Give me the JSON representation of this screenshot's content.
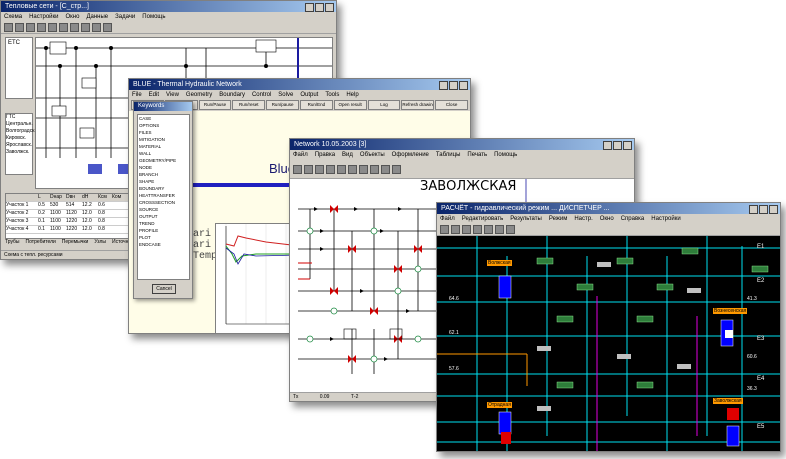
{
  "windows": {
    "w1": {
      "title": "Тепловые сети - [С_стр...]",
      "menu": [
        "Схема",
        "Настройки",
        "Окно",
        "Данные",
        "Задачи",
        "Помощь"
      ],
      "tree_root": "ЕТС",
      "list_items": [
        "ГТС",
        "Центральн.",
        "Волгоградск.",
        "Кировск.",
        "Ярославск.",
        "Заволжск."
      ],
      "table_headers": [
        "",
        "L",
        "Dнар",
        "Dвн",
        "dH",
        "Ксм",
        "Ком"
      ],
      "table_rows": [
        [
          "Участок 1",
          "0.5",
          "530",
          "514",
          "12.2",
          "0.6",
          ""
        ],
        [
          "Участок 2",
          "0.2",
          "1100",
          "1120",
          "12.0",
          "0.8",
          ""
        ],
        [
          "Участок 3",
          "0.1",
          "1100",
          "1220",
          "12.0",
          "0.8",
          ""
        ],
        [
          "Участок 4",
          "0.1",
          "1100",
          "1220",
          "12.0",
          "0.8",
          ""
        ]
      ],
      "tabs": [
        "Трубы",
        "Потребители",
        "Перемычки",
        "Узлы",
        "Источники"
      ],
      "status": "Схема с тепл. ресурсами"
    },
    "w2": {
      "title": "BLUE - Thermal Hydraulic Network",
      "menu": [
        "File",
        "Edit",
        "View",
        "Geometry",
        "Boundary",
        "Control",
        "Solve",
        "Output",
        "Tools",
        "Help"
      ],
      "buttons": [
        "Open",
        "Run/Stop",
        "Run/Pause",
        "Run/reset",
        "Run/pause",
        "Run/End",
        "Open result",
        "Log",
        "Refresh drawing",
        "Close"
      ],
      "blue_text": "BlueSt",
      "side_text": [
        "ari",
        "ari",
        "Temp"
      ],
      "popup_title": "Keywords",
      "keywords": [
        "CASE",
        "OPTIONS",
        "FILES",
        "MITIGATION",
        "MATERIAL",
        "WALL",
        "GEOMETRY/PIPE",
        "NODE",
        "BRANCH",
        "SHAPE",
        "BOUNDARY",
        "HEATTRANSFER",
        "CROSSSECTION",
        "SOURCE",
        "OUTPUT",
        "TREND",
        "PROFILE",
        "PLOT",
        "ENDCASE"
      ],
      "popup_button": "Cancel"
    },
    "w3": {
      "title": "Network 10.05.2003 [3]",
      "menu": [
        "Файл",
        "Правка",
        "Вид",
        "Объекты",
        "Оформление",
        "Таблицы",
        "Печать",
        "Помощь"
      ],
      "heading": "ЗАВОЛЖСКАЯ",
      "status": [
        "Тх",
        "0.09",
        "Т-2"
      ]
    },
    "w4": {
      "title": "РАСЧЁТ - гидравлический режим ... ДИСПЕТЧЕР ...",
      "menu": [
        "Файл",
        "Редактировать",
        "Результаты",
        "Режим",
        "Настр.",
        "Окно",
        "Справка",
        "Настройки"
      ],
      "labels": [
        "Волжская",
        "Вознесенская",
        "Отрадная",
        "Заволжская"
      ],
      "values": [
        "64.6",
        "62.1",
        "57.6",
        "41.3",
        "60.6",
        "36.3"
      ],
      "grid_labels": [
        "E1",
        "E2",
        "E3",
        "E4",
        "E5"
      ]
    }
  },
  "colors": {
    "title_bar_start": "#0a246a",
    "title_bar_end": "#a6caf0",
    "dispatch_bg": "#000000",
    "pipe_cyan": "#00e0f0",
    "valve_red": "#e00000",
    "highlight_orange": "#ff9900",
    "blue_accent": "#2020c0"
  }
}
